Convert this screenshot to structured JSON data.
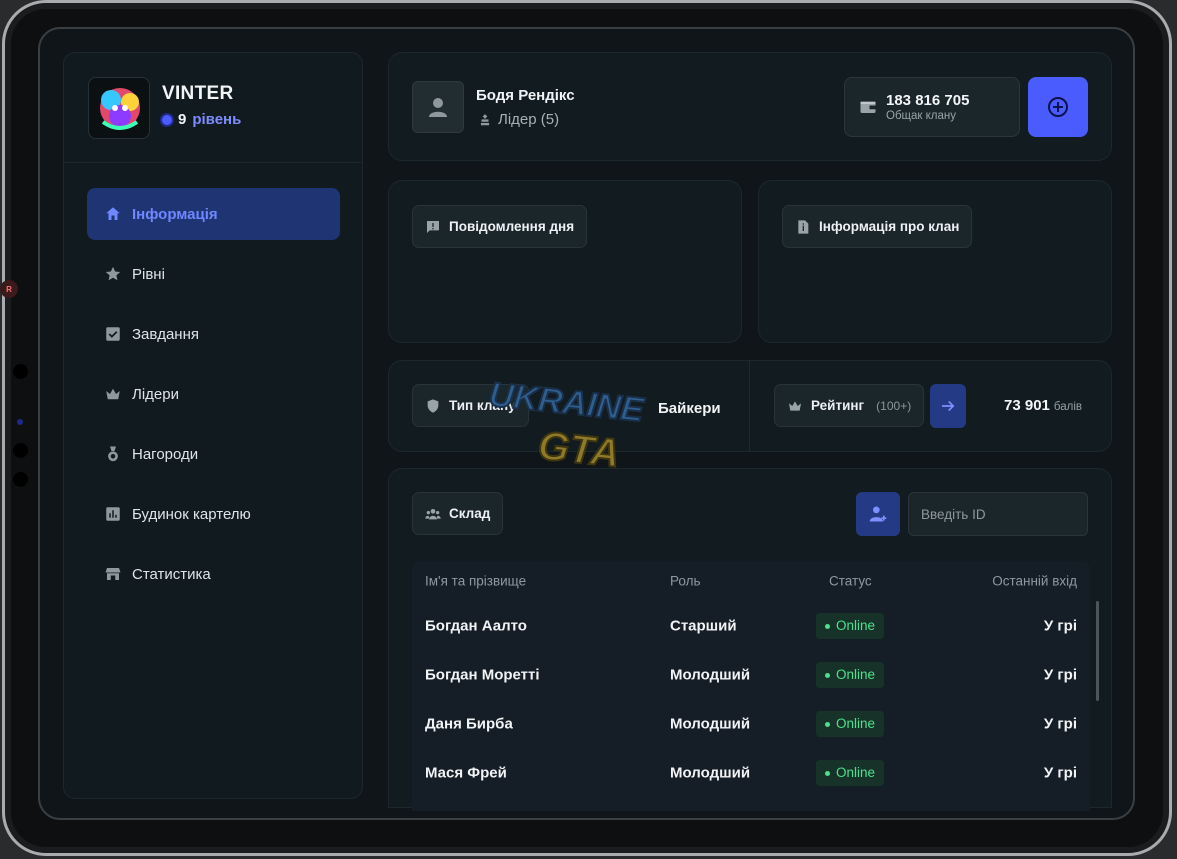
{
  "profile": {
    "name": "VINTER",
    "level_num": "9",
    "level_word": "рівень"
  },
  "nav": [
    {
      "label": "Інформація",
      "icon": "home-icon",
      "active": true
    },
    {
      "label": "Рівні",
      "icon": "star-icon"
    },
    {
      "label": "Завдання",
      "icon": "checkbox-icon"
    },
    {
      "label": "Лідери",
      "icon": "crown-icon"
    },
    {
      "label": "Нагороди",
      "icon": "medal-icon"
    },
    {
      "label": "Будинок картелю",
      "icon": "chart-icon"
    },
    {
      "label": "Статистика",
      "icon": "store-icon"
    }
  ],
  "header": {
    "user_name": "Бодя Рендікс",
    "user_role": "Лідер (5)",
    "bank_amount": "183 816 705",
    "bank_label": "Общак клану"
  },
  "panels": {
    "motd_label": "Повідомлення дня",
    "clan_info_label": "Інформація про клан"
  },
  "clan": {
    "type_label": "Тип клану",
    "type_value": "Байкери",
    "rating_label": "Рейтинг",
    "rating_note": "(100+)",
    "score_value": "73 901",
    "score_unit": "балів"
  },
  "roster": {
    "label": "Склад",
    "id_placeholder": "Введіть ID",
    "columns": [
      "Ім'я та прізвище",
      "Роль",
      "Статус",
      "Останній вхід"
    ],
    "rows": [
      {
        "name": "Богдан Аалто",
        "role": "Старший",
        "status": "Online",
        "last": "У грі"
      },
      {
        "name": "Богдан Моретті",
        "role": "Молодший",
        "status": "Online",
        "last": "У грі"
      },
      {
        "name": "Даня Бирба",
        "role": "Молодший",
        "status": "Online",
        "last": "У грі"
      },
      {
        "name": "Мася Фрей",
        "role": "Молодший",
        "status": "Online",
        "last": "У грі"
      }
    ]
  },
  "watermark": {
    "line1": "UKRAINE",
    "line2": "GTA"
  },
  "colors": {
    "accent": "#4b5cff",
    "active_nav": "#1f3473",
    "online": "#4ee08a"
  }
}
